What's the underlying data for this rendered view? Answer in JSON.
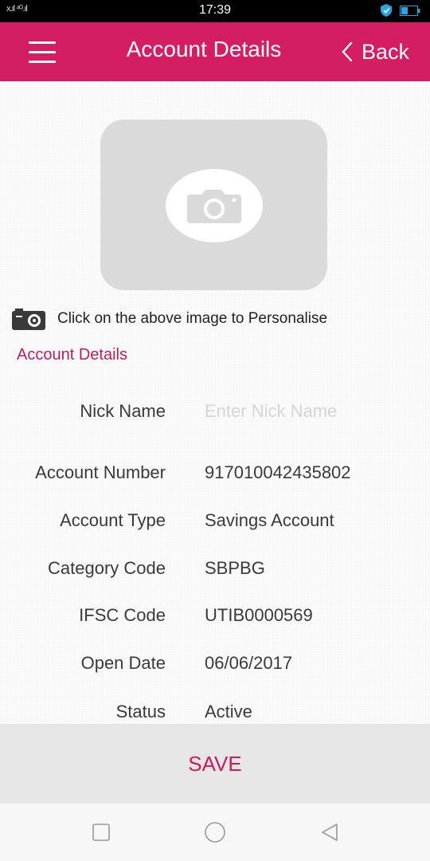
{
  "status_bar": {
    "signal": "x.ıl ⁴ᴳ.ıl",
    "time": "17:39"
  },
  "app_bar": {
    "title": "Account Details",
    "back_label": "Back",
    "accent_color": "#d41d62"
  },
  "photo": {
    "icon": "camera-icon"
  },
  "personalise": {
    "icon": "camera-icon",
    "text": "Click on the above image to Personalise"
  },
  "section_title": "Account Details",
  "fields": {
    "nick_name": {
      "label": "Nick Name",
      "placeholder": "Enter Nick Name",
      "value": ""
    },
    "account_number": {
      "label": "Account Number",
      "value": "917010042435802"
    },
    "account_type": {
      "label": "Account Type",
      "value": "Savings Account"
    },
    "category_code": {
      "label": "Category Code",
      "value": "SBPBG"
    },
    "ifsc_code": {
      "label": "IFSC Code",
      "value": "UTIB0000569"
    },
    "open_date": {
      "label": "Open Date",
      "value": "06/06/2017"
    },
    "status": {
      "label": "Status",
      "value": "Active"
    }
  },
  "save_label": "SAVE",
  "nav": {
    "recent": "square-icon",
    "home": "circle-icon",
    "back": "triangle-back-icon"
  }
}
